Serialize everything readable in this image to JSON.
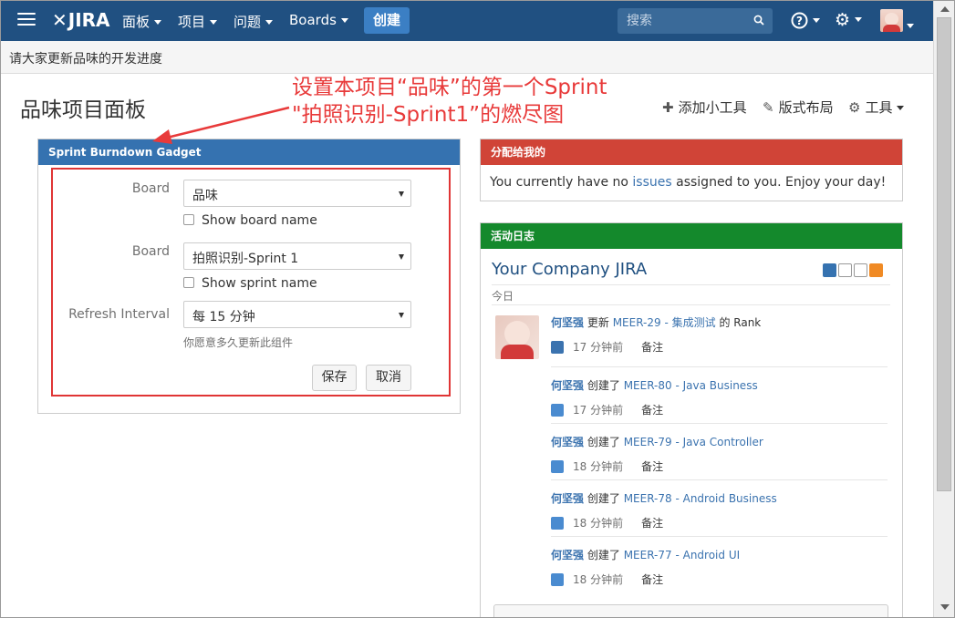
{
  "nav": {
    "logo": "JIRA",
    "menus": [
      "面板",
      "项目",
      "问题",
      "Boards"
    ],
    "create_label": "创建",
    "search_placeholder": "搜索",
    "help_icon": "help-icon",
    "settings_icon": "gear-icon"
  },
  "announcement": "请大家更新品味的开发进度",
  "page_title": "品味项目面板",
  "page_tools": {
    "add_gadget": "添加小工具",
    "layout": "版式布局",
    "tools": "工具"
  },
  "annotation": {
    "line1": "设置本项目“品味”的第一个Sprint",
    "line2": "\"拍照识别-Sprint1”的燃尽图",
    "color": "#e83a3a"
  },
  "burndown": {
    "title": "Sprint Burndown Gadget",
    "board_label": "Board",
    "board_value": "品味",
    "show_board_name": "Show board name",
    "sprint_label": "Board",
    "sprint_value": "拍照识别-Sprint 1",
    "show_sprint_name": "Show sprint name",
    "refresh_label": "Refresh Interval",
    "refresh_value": "每 15 分钟",
    "refresh_hint": "你愿意多久更新此组件",
    "save_label": "保存",
    "cancel_label": "取消"
  },
  "assigned": {
    "title": "分配给我的",
    "text_before": "You currently have no ",
    "link": "issues",
    "text_after": " assigned to you. Enjoy your day!"
  },
  "activity": {
    "title": "活动日志",
    "stream_title": "Your Company JIRA",
    "date_group": "今日",
    "entries": [
      {
        "user": "何坚强",
        "action": "更新",
        "issue": "MEER-29 - 集成测试",
        "suffix": "的 Rank",
        "time": "17 分钟前",
        "note": "备注",
        "type": "task"
      },
      {
        "user": "何坚强",
        "action": "创建了",
        "issue": "MEER-80 - Java Business",
        "suffix": "",
        "time": "17 分钟前",
        "note": "备注",
        "type": "subtask"
      },
      {
        "user": "何坚强",
        "action": "创建了",
        "issue": "MEER-79 - Java Controller",
        "suffix": "",
        "time": "18 分钟前",
        "note": "备注",
        "type": "subtask"
      },
      {
        "user": "何坚强",
        "action": "创建了",
        "issue": "MEER-78 - Android Business",
        "suffix": "",
        "time": "18 分钟前",
        "note": "备注",
        "type": "subtask"
      },
      {
        "user": "何坚强",
        "action": "创建了",
        "issue": "MEER-77 - Android UI",
        "suffix": "",
        "time": "18 分钟前",
        "note": "备注",
        "type": "subtask"
      }
    ]
  },
  "colors": {
    "nav": "#205081",
    "burndown_header": "#3572b0",
    "assigned_header": "#d04437",
    "activity_header": "#14892c",
    "link": "#3b73af"
  }
}
